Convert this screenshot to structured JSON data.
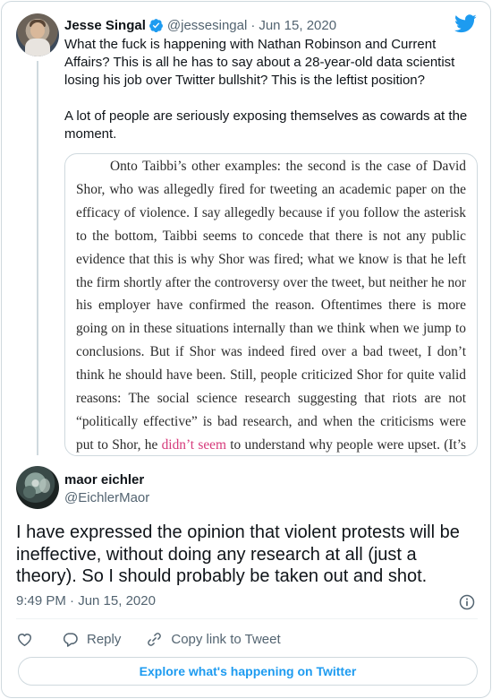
{
  "colors": {
    "brand_blue": "#1d9bf0",
    "text_primary": "#0f1419",
    "text_secondary": "#536471",
    "border": "#cfd9de",
    "link_pink": "#d63a7b"
  },
  "quoted_tweet": {
    "author_name": "Jesse Singal",
    "handle": "@jessesingal",
    "separator": "·",
    "date": "Jun 15, 2020",
    "verified_icon": "verified-badge-icon",
    "paragraphs": [
      "What the fuck is happening with Nathan Robinson and Current Affairs? This is all he has to say about a 28-year-old data scientist losing his job over Twitter bullshit? This is the leftist position?",
      "A lot of people are seriously exposing themselves as cowards at the moment."
    ],
    "image_text": {
      "before_link": "Onto Taibbi’s other examples: the second is the case of David Shor, who was allegedly fired for tweeting an academic paper on the efficacy of violence. I say allegedly because if you follow the asterisk to the bottom, Taibbi seems to concede that there is not any public evidence that this is why Shor was fired; what we know is that he left the firm shortly after the controversy over the tweet, but neither he nor his employer have confirmed the reason. Oftentimes there is more going on in these situations internally than we think when we jump to conclusions. But if Shor was indeed fired over a bad tweet, I don’t think he should have been. Still, people criticized Shor for quite valid reasons: The social science research suggesting that riots are not “politically effective” is bad research, and when the criticisms were put to Shor, he ",
      "link": "didn’t seem",
      "after_link": " to understand why people were upset. (It’s bad research, by"
    }
  },
  "main_tweet": {
    "author_name": "maor eichler",
    "handle": "@EichlerMaor",
    "text": "I have expressed the opinion that violent protests will be ineffective, without doing any research at all (just a theory). So I should probably be taken out and shot.",
    "timestamp": "9:49 PM · Jun 15, 2020"
  },
  "actions": {
    "like_icon": "heart-icon",
    "reply_label": "Reply",
    "reply_icon": "reply-bubble-icon",
    "copy_label": "Copy link to Tweet",
    "copy_icon": "link-icon"
  },
  "explore_button": {
    "label": "Explore what's happening on Twitter"
  }
}
